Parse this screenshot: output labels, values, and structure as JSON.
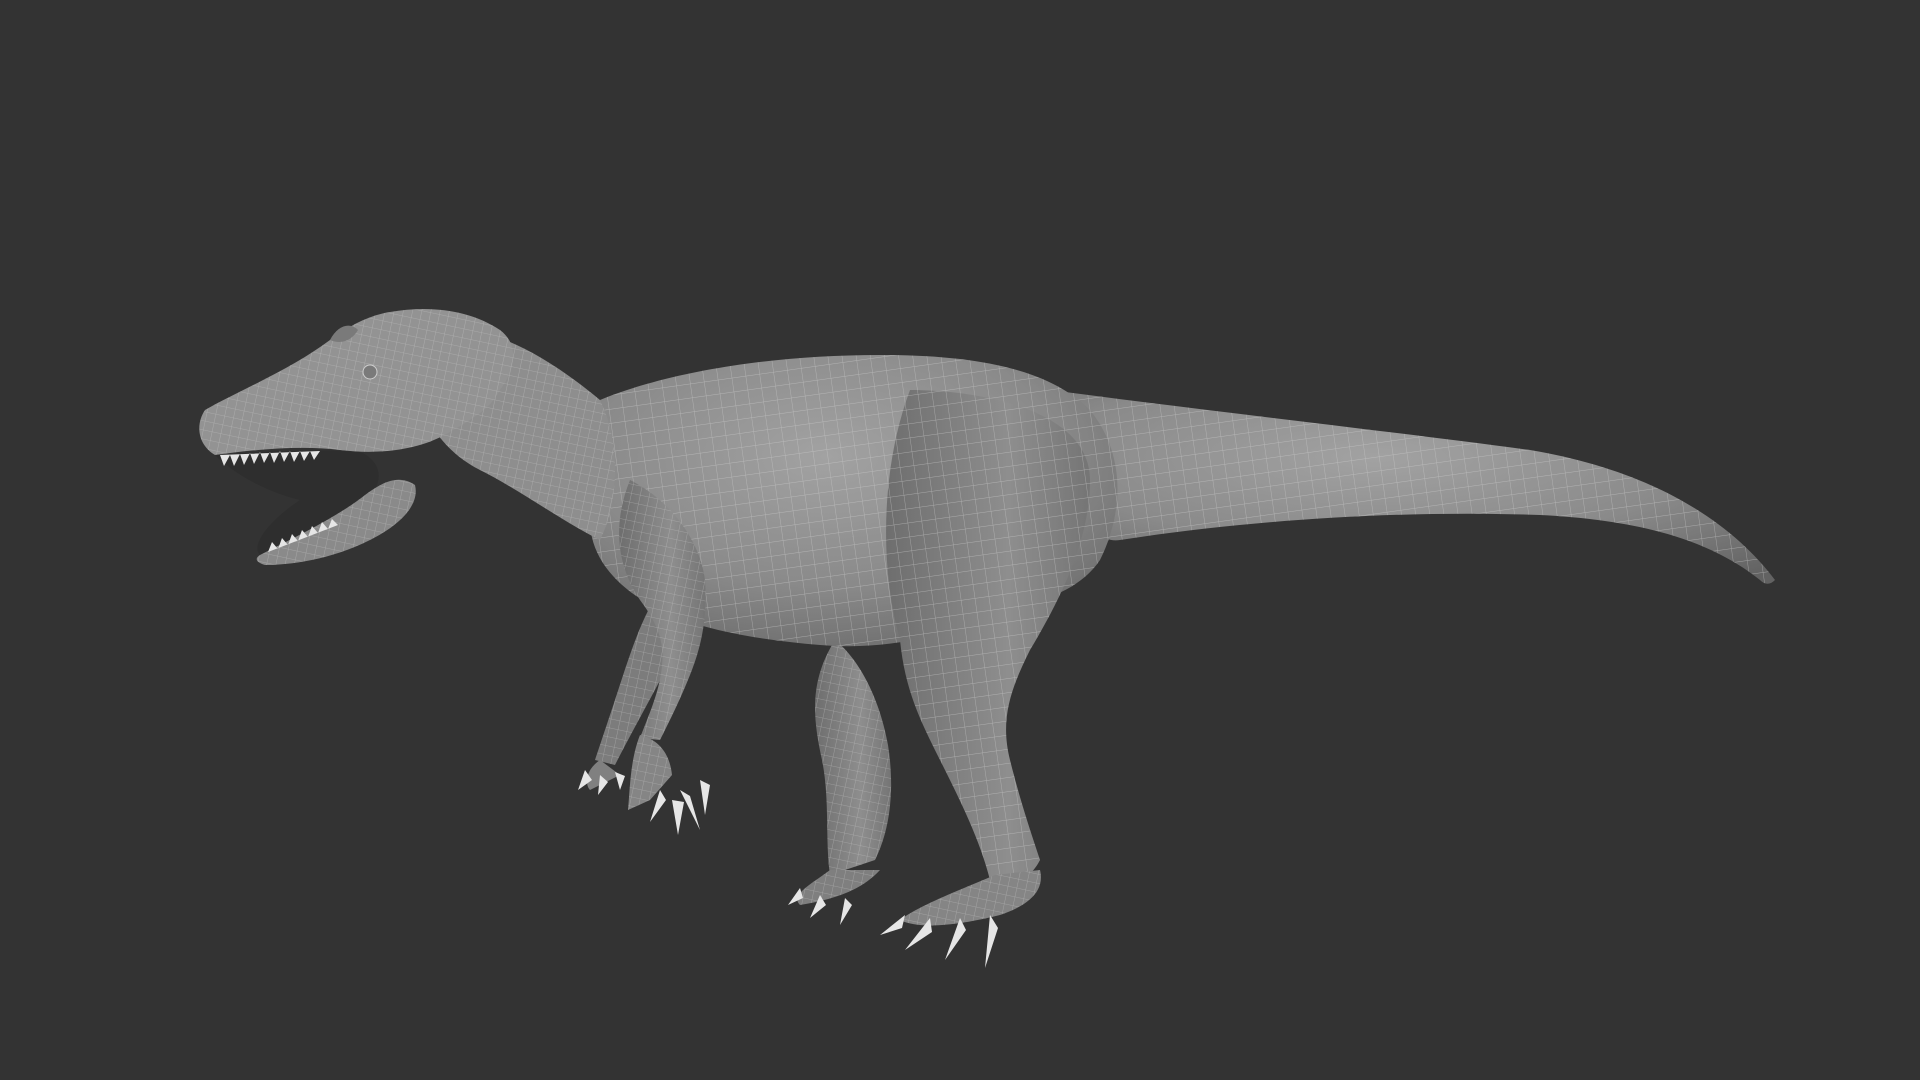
{
  "scene": {
    "background_color": "#333333",
    "subject": "dinosaur-wireframe-mesh",
    "mesh_color": "#8f8f8f",
    "wire_color": "#c9c9c9",
    "claw_color": "#e6e6e6"
  }
}
